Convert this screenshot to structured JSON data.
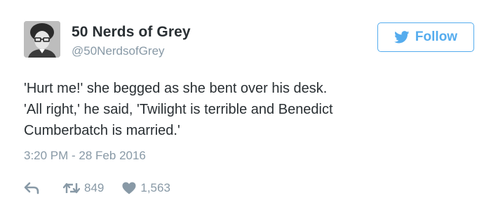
{
  "colors": {
    "accent": "#55acee",
    "text": "#292f33",
    "muted": "#8899a6"
  },
  "author": {
    "display_name": "50 Nerds of Grey",
    "handle": "@50NerdsofGrey",
    "avatar_icon": "profile-photo"
  },
  "follow_button": {
    "label": "Follow",
    "icon": "twitter-bird-icon"
  },
  "tweet": {
    "lines": [
      "'Hurt me!' she begged as she bent over his desk.",
      "'All right,' he said, 'Twilight is terrible and Benedict",
      "Cumberbatch is married.'"
    ],
    "timestamp": "3:20 PM - 28 Feb 2016"
  },
  "actions": {
    "reply_icon": "reply-icon",
    "retweet_icon": "retweet-icon",
    "retweet_count": "849",
    "like_icon": "heart-icon",
    "like_count": "1,563"
  }
}
